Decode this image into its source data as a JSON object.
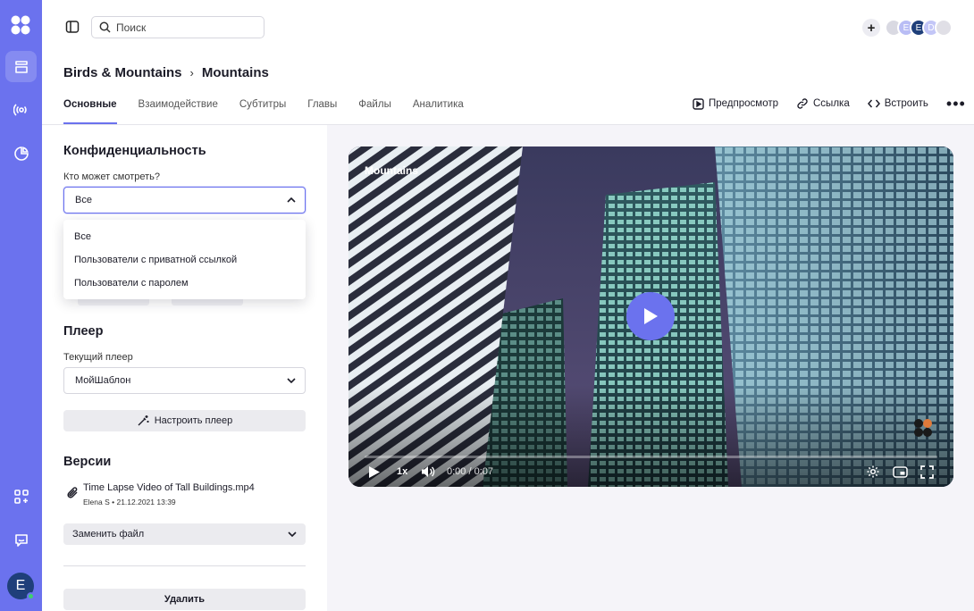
{
  "search": {
    "placeholder": "Поиск"
  },
  "header": {
    "breadcrumb_parent": "Birds & Mountains",
    "breadcrumb_separator": "›",
    "title": "Mountains"
  },
  "tabs": [
    {
      "label": "Основные",
      "active": true
    },
    {
      "label": "Взаимодействие"
    },
    {
      "label": "Субтитры"
    },
    {
      "label": "Главы"
    },
    {
      "label": "Файлы"
    },
    {
      "label": "Аналитика"
    }
  ],
  "actions": {
    "preview": "Предпросмотр",
    "link": "Ссылка",
    "embed": "Встроить"
  },
  "avatars": [
    {
      "initial": "",
      "color": "#d9d9e2"
    },
    {
      "initial": "E",
      "color": "#b9bdf5"
    },
    {
      "initial": "E",
      "color": "#1f3f7a"
    },
    {
      "initial": "D",
      "color": "#c3c6f7"
    },
    {
      "initial": "",
      "color": "#e0dfe6"
    }
  ],
  "privacy": {
    "title": "Конфиденциальность",
    "who_label": "Кто может смотреть?",
    "selected": "Все",
    "options": [
      "Все",
      "Пользователи с приватной ссылкой",
      "Пользователи с паролем"
    ]
  },
  "player": {
    "title": "Плеер",
    "current_label": "Текущий плеер",
    "selected": "МойШаблон",
    "configure_button": "Настроить плеер"
  },
  "versions": {
    "title": "Версии",
    "file_name": "Time Lapse Video of Tall Buildings.mp4",
    "file_meta": "Elena S • 21.12.2021 13:39",
    "replace_button": "Заменить файл",
    "delete_button": "Удалить"
  },
  "video": {
    "title": "Mountains",
    "speed": "1x",
    "time": "0:00 / 0:07",
    "progress": 0
  },
  "user": {
    "initial": "E"
  },
  "colors": {
    "accent": "#6b72ee",
    "rail": "#6b72ee",
    "online": "#3ecf6e"
  }
}
